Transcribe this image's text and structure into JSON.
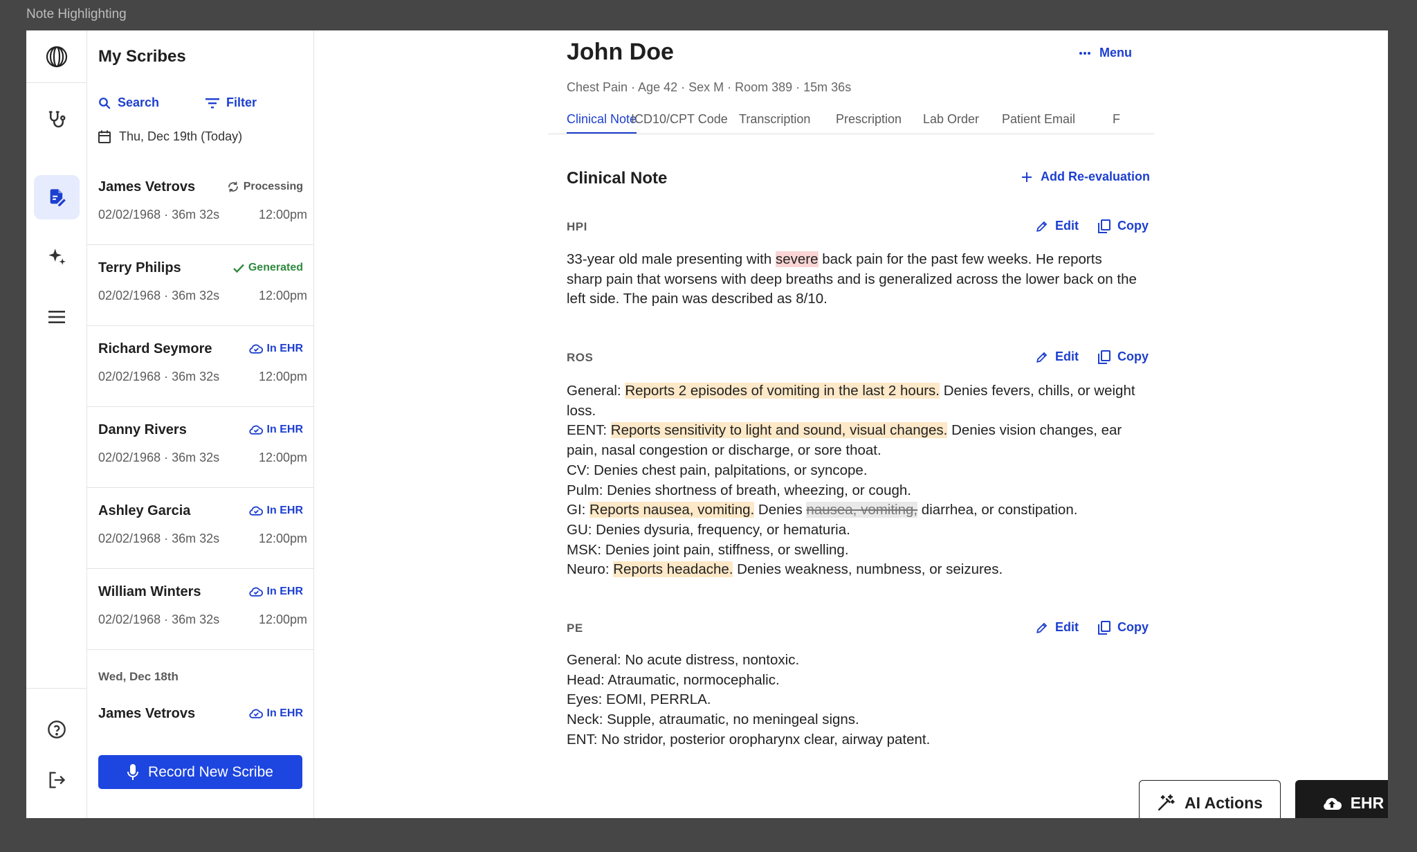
{
  "window": {
    "title": "Note Highlighting"
  },
  "list": {
    "title": "My Scribes",
    "search_label": "Search",
    "filter_label": "Filter",
    "date_today": "Thu, Dec 19th (Today)",
    "items": [
      {
        "name": "James Vetrovs",
        "meta": "02/02/1968 · 36m 32s",
        "time": "12:00pm",
        "status": "Processing"
      },
      {
        "name": "Terry Philips",
        "meta": "02/02/1968 · 36m 32s",
        "time": "12:00pm",
        "status": "Generated"
      },
      {
        "name": "Richard Seymore",
        "meta": "02/02/1968 · 36m 32s",
        "time": "12:00pm",
        "status": "In EHR"
      },
      {
        "name": "Danny Rivers",
        "meta": "02/02/1968 · 36m 32s",
        "time": "12:00pm",
        "status": "In EHR"
      },
      {
        "name": "Ashley Garcia",
        "meta": "02/02/1968 · 36m 32s",
        "time": "12:00pm",
        "status": "In EHR"
      },
      {
        "name": "William Winters",
        "meta": "02/02/1968 · 36m 32s",
        "time": "12:00pm",
        "status": "In EHR"
      }
    ],
    "date_prev": "Wed, Dec 18th",
    "prev_item": {
      "name": "James Vetrovs",
      "status": "In EHR"
    },
    "record_label": "Record New Scribe"
  },
  "patient": {
    "name": "John Doe",
    "meta": "Chest Pain · Age 42 · Sex M · Room 389 · 15m 36s",
    "menu_label": "Menu"
  },
  "tabs": [
    "Clinical Note",
    "ICD10/CPT Code",
    "Transcription",
    "Prescription",
    "Lab Order",
    "Patient Email",
    "F"
  ],
  "note": {
    "title": "Clinical Note",
    "add_reeval": "Add Re-evaluation",
    "edit_label": "Edit",
    "copy_label": "Copy",
    "hpi": {
      "label": "HPI",
      "pre": "33-year old male presenting with ",
      "highlight": "severe",
      "post": " back pain for the past few weeks. He reports sharp pain that worsens with deep breaths and is generalized across the lower back on the left side. The pain was described as 8/10."
    },
    "ros": {
      "label": "ROS",
      "general_pre": "General: ",
      "general_hl": "Reports 2 episodes of vomiting in the last 2 hours.",
      "general_post": " Denies fevers, chills, or weight loss.",
      "eent_pre": "EENT: ",
      "eent_hl": "Reports sensitivity to light and sound, visual changes.",
      "eent_post": " Denies vision changes, ear pain, nasal congestion or discharge, or sore thoat.",
      "cv": "CV: Denies chest pain, palpitations, or syncope.",
      "pulm": "Pulm: Denies shortness of breath, wheezing, or cough.",
      "gi_pre": "GI: ",
      "gi_hl": "Reports nausea, vomiting.",
      "gi_mid": " Denies ",
      "gi_strike": "nausea, vomiting,",
      "gi_post": " diarrhea, or constipation.",
      "gu": "GU: Denies dysuria, frequency, or hematuria.",
      "msk": "MSK: Denies joint pain, stiffness, or swelling.",
      "neuro_pre": "Neuro: ",
      "neuro_hl": "Reports headache.",
      "neuro_post": " Denies weakness, numbness, or seizures."
    },
    "pe": {
      "label": "PE",
      "lines": [
        "General: No acute distress, nontoxic.",
        "Head: Atraumatic, normocephalic.",
        "Eyes: EOMI, PERRLA.",
        "Neck: Supple, atraumatic, no meningeal signs.",
        "ENT: No stridor, posterior oropharynx clear, airway patent."
      ]
    }
  },
  "actions": {
    "ai_label": "AI Actions",
    "ehr_label": "EHR"
  },
  "colors": {
    "accent": "#1d3fcf",
    "primary_button": "#1d45e0",
    "highlight_red": "#fbd5d5",
    "highlight_amber": "#fde8c7",
    "generated": "#2f8a3f"
  }
}
